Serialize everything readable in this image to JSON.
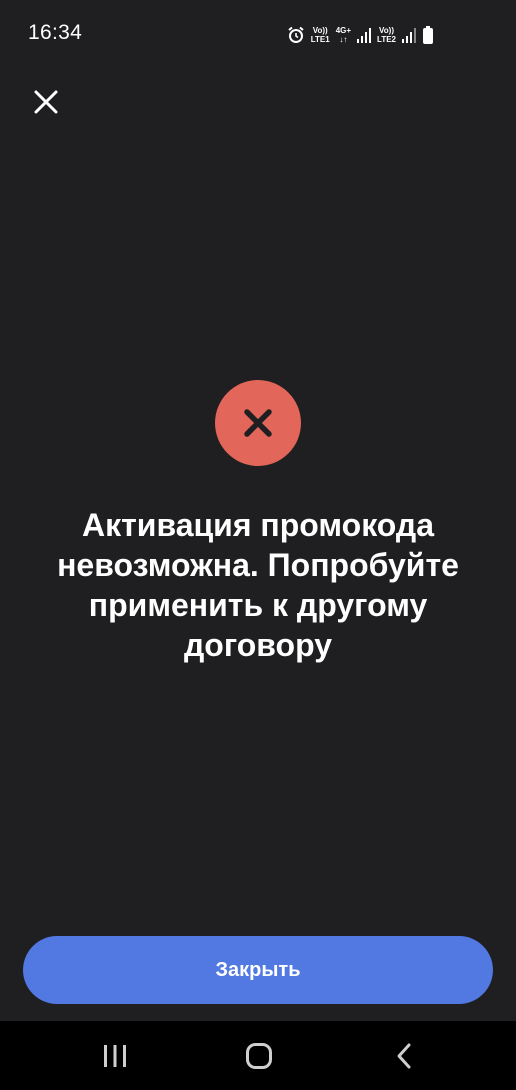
{
  "status_bar": {
    "time": "16:34",
    "sim1_top": "Vo))",
    "sim1_bottom": "LTE1",
    "net_top": "4G+",
    "net_bottom": "↓↑",
    "sim2_top": "Vo))",
    "sim2_bottom": "LTE2",
    "icons": [
      "alarm-icon",
      "signal-icon",
      "signal-icon",
      "battery-icon"
    ]
  },
  "header": {
    "close_icon": "close-icon"
  },
  "result": {
    "status_icon": "error-icon",
    "status_color": "#e2665a",
    "message": "Активация промокода\nневозможна. Попробуйте\nприменить к другому\nдоговору"
  },
  "footer": {
    "close_label": "Закрыть",
    "button_color": "#5278e2"
  },
  "nav_bar": {
    "icons": [
      "recent-apps-icon",
      "home-icon",
      "back-icon"
    ]
  }
}
